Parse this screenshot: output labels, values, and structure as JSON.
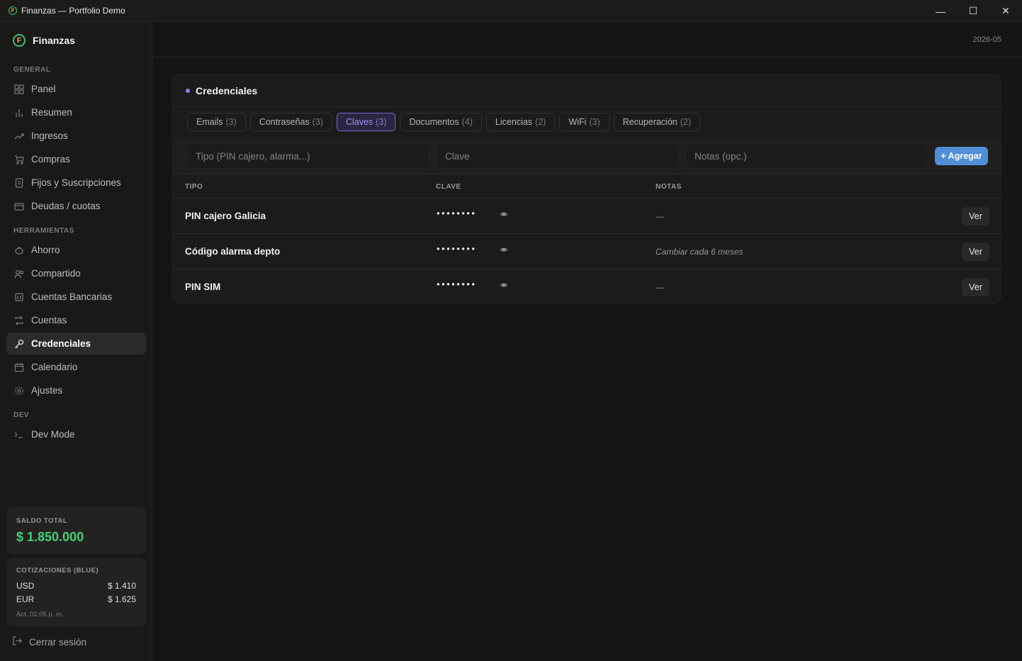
{
  "window": {
    "title": "Finanzas — Portfolio Demo",
    "controls": {
      "minimize": "—",
      "maximize": "☐",
      "close": "✕"
    }
  },
  "sidebar": {
    "brand": "Finanzas",
    "brand_logo_letter": "F",
    "sections": {
      "general": "GENERAL",
      "herramientas": "HERRAMIENTAS",
      "dev": "DEV"
    },
    "items": [
      {
        "label": "Panel",
        "icon": "grid-icon"
      },
      {
        "label": "Resumen",
        "icon": "bar-chart-icon"
      },
      {
        "label": "Ingresos",
        "icon": "trend-up-icon"
      },
      {
        "label": "Compras",
        "icon": "cart-icon"
      },
      {
        "label": "Fijos y Suscripciones",
        "icon": "document-icon"
      },
      {
        "label": "Deudas / cuotas",
        "icon": "card-icon"
      },
      {
        "label": "Ahorro",
        "icon": "piggy-bank-icon"
      },
      {
        "label": "Compartido",
        "icon": "users-icon"
      },
      {
        "label": "Cuentas Bancarias",
        "icon": "bank-icon"
      },
      {
        "label": "Cuentas",
        "icon": "repeat-icon"
      },
      {
        "label": "Credenciales",
        "icon": "key-icon",
        "active": true
      },
      {
        "label": "Calendario",
        "icon": "calendar-icon"
      },
      {
        "label": "Ajustes",
        "icon": "gear-icon"
      },
      {
        "label": "Dev Mode",
        "icon": "terminal-icon"
      }
    ],
    "saldo": {
      "label": "SALDO TOTAL",
      "value": "$ 1.850.000"
    },
    "cotizaciones": {
      "label": "COTIZACIONES (BLUE)",
      "rows": [
        {
          "currency": "USD",
          "value": "$ 1.410"
        },
        {
          "currency": "EUR",
          "value": "$ 1.625"
        }
      ],
      "updated": "Act. 02:05 p. m."
    },
    "logout": "Cerrar sesión"
  },
  "header": {
    "period": "2026-05"
  },
  "panel": {
    "title": "Credenciales",
    "accent": "#9b7bf0",
    "tabs": [
      {
        "label": "Emails",
        "count": "(3)"
      },
      {
        "label": "Contraseñas",
        "count": "(3)"
      },
      {
        "label": "Claves",
        "count": "(3)",
        "active": true
      },
      {
        "label": "Documentos",
        "count": "(4)"
      },
      {
        "label": "Licencias",
        "count": "(2)"
      },
      {
        "label": "WiFi",
        "count": "(3)"
      },
      {
        "label": "Recuperación",
        "count": "(2)"
      }
    ],
    "form": {
      "tipo_placeholder": "Tipo (PIN cajero, alarma...)",
      "clave_placeholder": "Clave",
      "notas_placeholder": "Notas (opc.)",
      "add_label": "+ Agregar",
      "add_color": "#4e8fd8"
    },
    "table": {
      "headers": {
        "tipo": "TIPO",
        "clave": "CLAVE",
        "notas": "NOTAS"
      },
      "rows": [
        {
          "tipo": "PIN cajero Galicia",
          "clave": "••••••••",
          "notas": "—",
          "action": "Ver"
        },
        {
          "tipo": "Código alarma depto",
          "clave": "••••••••",
          "notas": "Cambiar cada 6 meses",
          "action": "Ver"
        },
        {
          "tipo": "PIN SIM",
          "clave": "••••••••",
          "notas": "—",
          "action": "Ver"
        }
      ]
    }
  }
}
